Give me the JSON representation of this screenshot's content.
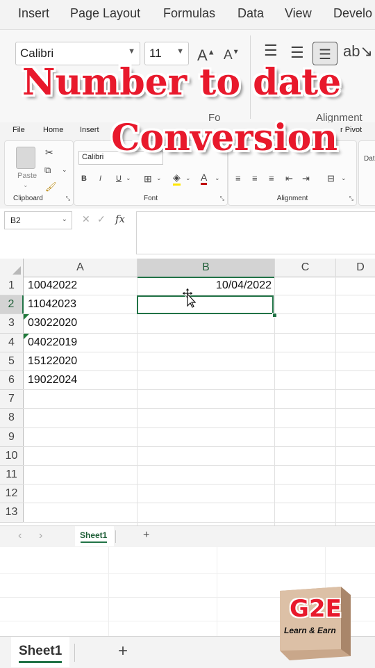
{
  "overlay": {
    "line1": "Number to date",
    "line2": "Conversion"
  },
  "top_ribbon": {
    "tabs": [
      "Insert",
      "Page Layout",
      "Formulas",
      "Data",
      "View",
      "Develo"
    ],
    "font_name": "Calibri",
    "font_size": "11",
    "partial_labels": [
      "Fo",
      "Alignment"
    ]
  },
  "ribbon": {
    "tabs": [
      "File",
      "Home",
      "Insert",
      "Dra",
      "r Pivot"
    ],
    "paste_label": "Paste",
    "font_name": "Calibri",
    "bold": "B",
    "italic": "I",
    "underline": "U",
    "groups": {
      "clipboard": "Clipboard",
      "font": "Font",
      "alignment": "Alignment"
    },
    "partial_right": "Dat"
  },
  "formula_bar": {
    "name_box": "B2",
    "fx": "fx",
    "cancel": "✕",
    "enter": "✓",
    "value": ""
  },
  "grid": {
    "columns": [
      "A",
      "B",
      "C",
      "D"
    ],
    "selected_column": "B",
    "rows": [
      "1",
      "2",
      "3",
      "4",
      "5",
      "6",
      "7",
      "8",
      "9",
      "10",
      "11",
      "12",
      "13"
    ],
    "selected_row": "2",
    "column_a": [
      "10042022",
      "11042023",
      "03022020",
      "04022019",
      "15122020",
      "19022024"
    ],
    "b1": "10/04/2022",
    "active_cell": "B2"
  },
  "sheet_tabs": {
    "active": "Sheet1",
    "add": "+",
    "prev": "‹",
    "next": "›"
  },
  "bottom_tabs": {
    "active": "Sheet1",
    "add": "+"
  },
  "logo": {
    "title": "G2E",
    "subtitle": "Learn & Earn"
  },
  "colors": {
    "accent": "#217346",
    "overlay_red": "#e8192c",
    "error_triangle": "#1f7a3a",
    "font_color_underline": "#c00000",
    "highlight": "#ffe600"
  },
  "icons": [
    "cut-icon",
    "copy-icon",
    "format-painter-icon",
    "paste-icon",
    "move-cursor-icon",
    "borders-icon",
    "fill-color-icon",
    "font-color-icon",
    "align-left-icon",
    "align-center-icon",
    "align-right-icon",
    "indent-decrease-icon",
    "indent-increase-icon",
    "merge-icon",
    "orientation-icon",
    "increase-font-icon",
    "decrease-font-icon"
  ]
}
